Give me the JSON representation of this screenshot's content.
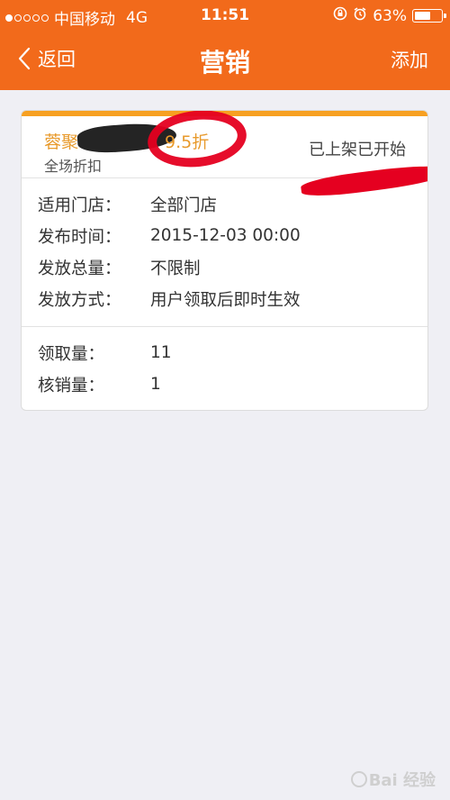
{
  "status_bar": {
    "carrier": "中国移动",
    "network": "4G",
    "time": "11:51",
    "battery": "63%",
    "battery_level": 0.63,
    "signal_bars_filled": 1,
    "signal_bars_total": 5
  },
  "nav": {
    "back_label": "返回",
    "title": "营销",
    "add_label": "添加"
  },
  "card": {
    "name": "蓉聚",
    "discount": "9.5折",
    "subtitle": "全场折扣",
    "status": "已上架已开始",
    "details": [
      {
        "label": "适用门店：",
        "value": "全部门店"
      },
      {
        "label": "发布时间：",
        "value": "2015-12-03 00:00"
      },
      {
        "label": "发放总量：",
        "value": "不限制"
      },
      {
        "label": "发放方式：",
        "value": "用户领取后即时生效"
      }
    ],
    "stats": [
      {
        "label": "领取量：",
        "value": "11"
      },
      {
        "label": "核销量：",
        "value": "1"
      }
    ]
  },
  "watermark": "Bai 经验",
  "colors": {
    "accent": "#f26a1b",
    "card_top": "#f7a021",
    "highlight_text": "#e89a2c",
    "annotation_red": "#e50020"
  }
}
